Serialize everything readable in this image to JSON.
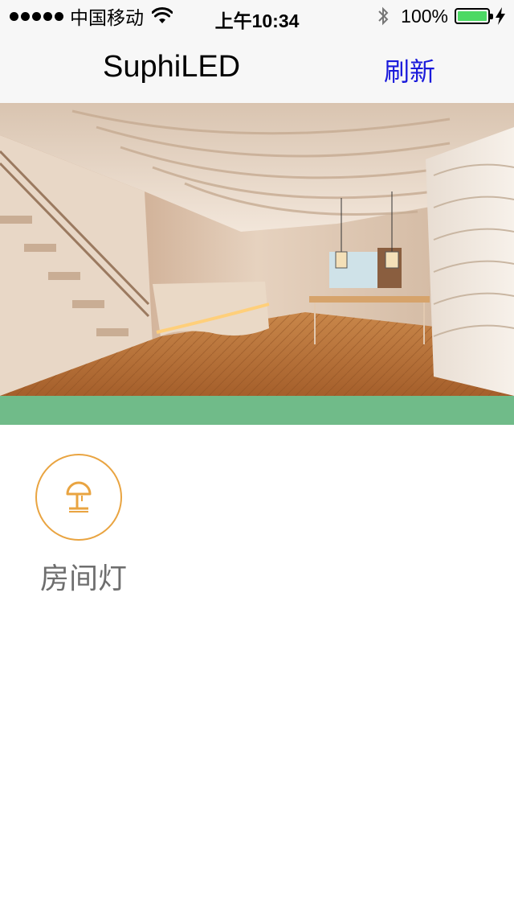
{
  "status_bar": {
    "carrier": "中国移动",
    "time": "上午10:34",
    "battery_percent": "100%",
    "battery_level": 1.0,
    "icons": [
      "signal-dots-icon",
      "wifi-icon",
      "bluetooth-icon",
      "battery-icon",
      "charging-icon"
    ]
  },
  "nav": {
    "title": "SuphiLED",
    "refresh_label": "刷新"
  },
  "banner": {
    "page_count": 1,
    "current_page": 1
  },
  "devices": [
    {
      "label": "房间灯",
      "icon": "lamp-icon"
    }
  ],
  "colors": {
    "accent_green": "#70bb89",
    "lamp_orange": "#e9a441",
    "link_blue": "#1a1adb",
    "battery_green": "#4cd964"
  }
}
